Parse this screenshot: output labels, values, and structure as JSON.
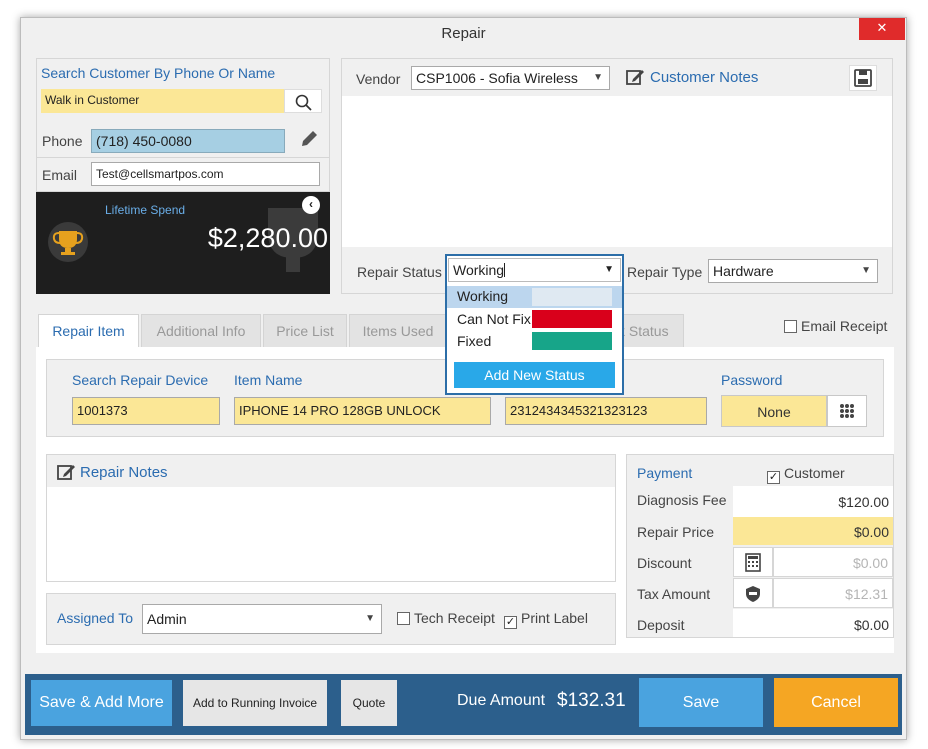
{
  "window": {
    "title": "Repair",
    "close": "✕"
  },
  "customer": {
    "search_label": "Search Customer By Phone Or Name",
    "search_value": "Walk in Customer",
    "phone_label": "Phone",
    "phone_value": "(718) 450-0080",
    "email_label": "Email",
    "email_value": "Test@cellsmartpos.com",
    "lifetime_label": "Lifetime Spend",
    "lifetime_value": "$2,280.00"
  },
  "vendor": {
    "label": "Vendor",
    "value": "CSP1006 - Sofia Wireless",
    "customer_notes": "Customer Notes"
  },
  "status": {
    "label": "Repair Status",
    "value": "Working",
    "options": [
      {
        "label": "Working",
        "color": "#dfe9f2"
      },
      {
        "label": "Can Not Fix",
        "color": "#d9001b"
      },
      {
        "label": "Fixed",
        "color": "#17a589"
      }
    ],
    "add_new": "Add New Status",
    "type_label": "Repair Type",
    "type_value": "Hardware"
  },
  "tabs": [
    "Repair Item",
    "Additional Info",
    "Price List",
    "Items Used",
    "k Status"
  ],
  "email_receipt": "Email Receipt",
  "item": {
    "search_label": "Search Repair Device",
    "search_value": "1001373",
    "name_label": "Item Name",
    "name_value": "IPHONE 14 PRO 128GB UNLOCK",
    "serial_value": "231243434532132312​3",
    "password_label": "Password",
    "password_value": "None"
  },
  "notes": {
    "label": "Repair Notes"
  },
  "assigned": {
    "label": "Assigned To",
    "value": "Admin",
    "tech_receipt": "Tech Receipt",
    "print_label": "Print Label"
  },
  "payment": {
    "title": "Payment",
    "customer_receipt": "Customer Receipt",
    "diagnosis_label": "Diagnosis Fee",
    "diagnosis_value": "$120.00",
    "repair_label": "Repair Price",
    "repair_value": "$0.00",
    "discount_label": "Discount",
    "discount_value": "$0.00",
    "tax_label": "Tax Amount",
    "tax_value": "$12.31",
    "deposit_label": "Deposit",
    "deposit_value": "$0.00"
  },
  "footer": {
    "save_add_more": "Save & Add More",
    "add_running": "Add to Running Invoice",
    "quote": "Quote",
    "due_label": "Due Amount",
    "due_value": "$132.31",
    "save": "Save",
    "cancel": "Cancel"
  },
  "colors": {
    "footer": "#2c5f8c",
    "save": "#4aa3df",
    "cancel": "#f5a623",
    "add_status": "#29a8e8"
  }
}
